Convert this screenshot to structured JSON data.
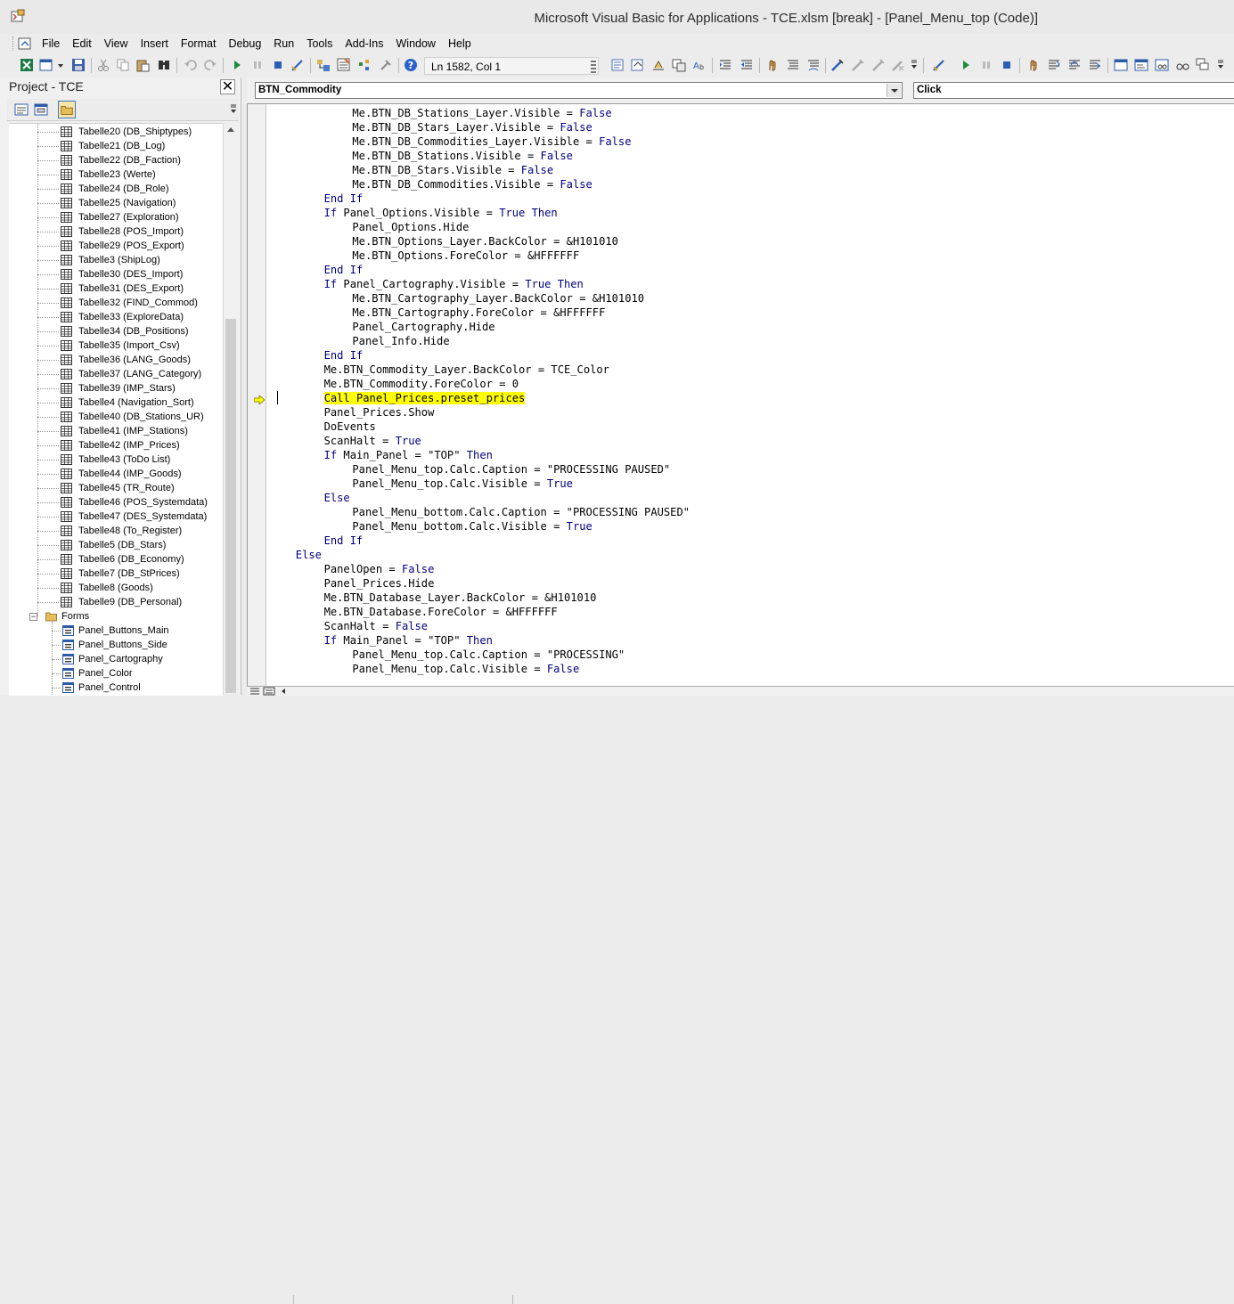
{
  "window": {
    "title": "Microsoft Visual Basic for Applications - TCE.xlsm [break] - [Panel_Menu_top (Code)]"
  },
  "menubar": {
    "items": [
      "File",
      "Edit",
      "View",
      "Insert",
      "Format",
      "Debug",
      "Run",
      "Tools",
      "Add-Ins",
      "Window",
      "Help"
    ]
  },
  "toolbar": {
    "position_label": "Ln 1582, Col 1"
  },
  "project": {
    "title": "Project - TCE",
    "tree": [
      {
        "label": "Tabelle20 (DB_Shiptypes)",
        "type": "sheet"
      },
      {
        "label": "Tabelle21 (DB_Log)",
        "type": "sheet"
      },
      {
        "label": "Tabelle22 (DB_Faction)",
        "type": "sheet"
      },
      {
        "label": "Tabelle23 (Werte)",
        "type": "sheet"
      },
      {
        "label": "Tabelle24 (DB_Role)",
        "type": "sheet"
      },
      {
        "label": "Tabelle25 (Navigation)",
        "type": "sheet"
      },
      {
        "label": "Tabelle27 (Exploration)",
        "type": "sheet"
      },
      {
        "label": "Tabelle28 (POS_Import)",
        "type": "sheet"
      },
      {
        "label": "Tabelle29 (POS_Export)",
        "type": "sheet"
      },
      {
        "label": "Tabelle3 (ShipLog)",
        "type": "sheet"
      },
      {
        "label": "Tabelle30 (DES_Import)",
        "type": "sheet"
      },
      {
        "label": "Tabelle31 (DES_Export)",
        "type": "sheet"
      },
      {
        "label": "Tabelle32 (FIND_Commod)",
        "type": "sheet"
      },
      {
        "label": "Tabelle33 (ExploreData)",
        "type": "sheet"
      },
      {
        "label": "Tabelle34 (DB_Positions)",
        "type": "sheet"
      },
      {
        "label": "Tabelle35 (Import_Csv)",
        "type": "sheet"
      },
      {
        "label": "Tabelle36 (LANG_Goods)",
        "type": "sheet"
      },
      {
        "label": "Tabelle37 (LANG_Category)",
        "type": "sheet"
      },
      {
        "label": "Tabelle39 (IMP_Stars)",
        "type": "sheet"
      },
      {
        "label": "Tabelle4 (Navigation_Sort)",
        "type": "sheet"
      },
      {
        "label": "Tabelle40 (DB_Stations_UR)",
        "type": "sheet"
      },
      {
        "label": "Tabelle41 (IMP_Stations)",
        "type": "sheet"
      },
      {
        "label": "Tabelle42 (IMP_Prices)",
        "type": "sheet"
      },
      {
        "label": "Tabelle43 (ToDo List)",
        "type": "sheet"
      },
      {
        "label": "Tabelle44 (IMP_Goods)",
        "type": "sheet"
      },
      {
        "label": "Tabelle45 (TR_Route)",
        "type": "sheet"
      },
      {
        "label": "Tabelle46 (POS_Systemdata)",
        "type": "sheet"
      },
      {
        "label": "Tabelle47 (DES_Systemdata)",
        "type": "sheet"
      },
      {
        "label": "Tabelle48 (To_Register)",
        "type": "sheet"
      },
      {
        "label": "Tabelle5 (DB_Stars)",
        "type": "sheet"
      },
      {
        "label": "Tabelle6 (DB_Economy)",
        "type": "sheet"
      },
      {
        "label": "Tabelle7 (DB_StPrices)",
        "type": "sheet"
      },
      {
        "label": "Tabelle8 (Goods)",
        "type": "sheet"
      },
      {
        "label": "Tabelle9 (DB_Personal)",
        "type": "sheet"
      },
      {
        "label": "Forms",
        "type": "folder"
      },
      {
        "label": "Panel_Buttons_Main",
        "type": "form"
      },
      {
        "label": "Panel_Buttons_Side",
        "type": "form"
      },
      {
        "label": "Panel_Cartography",
        "type": "form"
      },
      {
        "label": "Panel_Color",
        "type": "form"
      },
      {
        "label": "Panel_Control",
        "type": "form"
      }
    ]
  },
  "code_window": {
    "object_combo": "BTN_Commodity",
    "procedure_combo": "Click",
    "lines": [
      {
        "indent": 12,
        "tokens": [
          [
            "Me.BTN_DB_Stations_Layer.Visible = ",
            "n"
          ],
          [
            "False",
            "k"
          ]
        ]
      },
      {
        "indent": 12,
        "tokens": [
          [
            "Me.BTN_DB_Stars_Layer.Visible = ",
            "n"
          ],
          [
            "False",
            "k"
          ]
        ]
      },
      {
        "indent": 12,
        "tokens": [
          [
            "Me.BTN_DB_Commodities_Layer.Visible = ",
            "n"
          ],
          [
            "False",
            "k"
          ]
        ]
      },
      {
        "indent": 12,
        "tokens": [
          [
            "Me.BTN_DB_Stations.Visible = ",
            "n"
          ],
          [
            "False",
            "k"
          ]
        ]
      },
      {
        "indent": 12,
        "tokens": [
          [
            "Me.BTN_DB_Stars.Visible = ",
            "n"
          ],
          [
            "False",
            "k"
          ]
        ]
      },
      {
        "indent": 12,
        "tokens": [
          [
            "Me.BTN_DB_Commodities.Visible = ",
            "n"
          ],
          [
            "False",
            "k"
          ]
        ]
      },
      {
        "indent": 8,
        "tokens": [
          [
            "End If",
            "k"
          ]
        ]
      },
      {
        "indent": 8,
        "tokens": [
          [
            "If",
            "k"
          ],
          [
            " Panel_Options.Visible = ",
            "n"
          ],
          [
            "True Then",
            "k"
          ]
        ]
      },
      {
        "indent": 12,
        "tokens": [
          [
            "Panel_Options.Hide",
            "n"
          ]
        ]
      },
      {
        "indent": 12,
        "tokens": [
          [
            "Me.BTN_Options_Layer.BackColor = &H101010",
            "n"
          ]
        ]
      },
      {
        "indent": 12,
        "tokens": [
          [
            "Me.BTN_Options.ForeColor = &HFFFFFF",
            "n"
          ]
        ]
      },
      {
        "indent": 8,
        "tokens": [
          [
            "End If",
            "k"
          ]
        ]
      },
      {
        "indent": 8,
        "tokens": [
          [
            "If",
            "k"
          ],
          [
            " Panel_Cartography.Visible = ",
            "n"
          ],
          [
            "True Then",
            "k"
          ]
        ]
      },
      {
        "indent": 12,
        "tokens": [
          [
            "Me.BTN_Cartography_Layer.BackColor = &H101010",
            "n"
          ]
        ]
      },
      {
        "indent": 12,
        "tokens": [
          [
            "Me.BTN_Cartography.ForeColor = &HFFFFFF",
            "n"
          ]
        ]
      },
      {
        "indent": 12,
        "tokens": [
          [
            "Panel_Cartography.Hide",
            "n"
          ]
        ]
      },
      {
        "indent": 12,
        "tokens": [
          [
            "Panel_Info.Hide",
            "n"
          ]
        ]
      },
      {
        "indent": 8,
        "tokens": [
          [
            "End If",
            "k"
          ]
        ]
      },
      {
        "indent": 8,
        "tokens": [
          [
            "Me.BTN_Commodity_Layer.BackColor = TCE_Color",
            "n"
          ]
        ]
      },
      {
        "indent": 8,
        "tokens": [
          [
            "Me.BTN_Commodity.ForeColor = 0",
            "n"
          ]
        ]
      },
      {
        "indent": 8,
        "highlight": true,
        "tokens": [
          [
            "Call",
            "k"
          ],
          [
            " Panel_Prices.preset_prices",
            "n"
          ]
        ]
      },
      {
        "indent": 8,
        "tokens": [
          [
            "Panel_Prices.Show",
            "n"
          ]
        ]
      },
      {
        "indent": 8,
        "tokens": [
          [
            "DoEvents",
            "n"
          ]
        ]
      },
      {
        "indent": 8,
        "tokens": [
          [
            "ScanHalt = ",
            "n"
          ],
          [
            "True",
            "k"
          ]
        ]
      },
      {
        "indent": 8,
        "tokens": [
          [
            "If",
            "k"
          ],
          [
            " Main_Panel = \"TOP\" ",
            "n"
          ],
          [
            "Then",
            "k"
          ]
        ]
      },
      {
        "indent": 12,
        "tokens": [
          [
            "Panel_Menu_top.Calc.Caption = \"PROCESSING PAUSED\"",
            "n"
          ]
        ]
      },
      {
        "indent": 12,
        "tokens": [
          [
            "Panel_Menu_top.Calc.Visible = ",
            "n"
          ],
          [
            "True",
            "k"
          ]
        ]
      },
      {
        "indent": 8,
        "tokens": [
          [
            "Else",
            "k"
          ]
        ]
      },
      {
        "indent": 12,
        "tokens": [
          [
            "Panel_Menu_bottom.Calc.Caption = \"PROCESSING PAUSED\"",
            "n"
          ]
        ]
      },
      {
        "indent": 12,
        "tokens": [
          [
            "Panel_Menu_bottom.Calc.Visible = ",
            "n"
          ],
          [
            "True",
            "k"
          ]
        ]
      },
      {
        "indent": 8,
        "tokens": [
          [
            "End If",
            "k"
          ]
        ]
      },
      {
        "indent": 4,
        "tokens": [
          [
            "Else",
            "k"
          ]
        ]
      },
      {
        "indent": 8,
        "tokens": [
          [
            "PanelOpen = ",
            "n"
          ],
          [
            "False",
            "k"
          ]
        ]
      },
      {
        "indent": 8,
        "tokens": [
          [
            "Panel_Prices.Hide",
            "n"
          ]
        ]
      },
      {
        "indent": 8,
        "tokens": [
          [
            "Me.BTN_Database_Layer.BackColor = &H101010",
            "n"
          ]
        ]
      },
      {
        "indent": 8,
        "tokens": [
          [
            "Me.BTN_Database.ForeColor = &HFFFFFF",
            "n"
          ]
        ]
      },
      {
        "indent": 8,
        "tokens": [
          [
            "ScanHalt = ",
            "n"
          ],
          [
            "False",
            "k"
          ]
        ]
      },
      {
        "indent": 8,
        "tokens": [
          [
            "If",
            "k"
          ],
          [
            " Main_Panel = \"TOP\" ",
            "n"
          ],
          [
            "Then",
            "k"
          ]
        ]
      },
      {
        "indent": 12,
        "tokens": [
          [
            "Panel_Menu_top.Calc.Caption = \"PROCESSING\"",
            "n"
          ]
        ]
      },
      {
        "indent": 12,
        "tokens": [
          [
            "Panel_Menu_top.Calc.Visible = ",
            "n"
          ],
          [
            "False",
            "k"
          ]
        ]
      }
    ]
  },
  "colors": {
    "keyword": "#00007f",
    "highlight": "#ffff00",
    "execution_arrow": "#ffff00"
  }
}
